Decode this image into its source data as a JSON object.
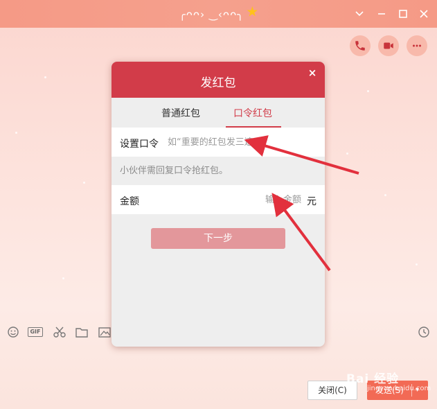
{
  "window": {
    "title": "╭ᴖᴖ› ‿‹ᴖᴖ╮",
    "badge_icon": "vip-star-icon",
    "controls": [
      "chevron-down-icon",
      "minimize-icon",
      "maximize-icon",
      "close-icon"
    ]
  },
  "call_buttons": [
    {
      "name": "voice-call",
      "icon": "phone-icon"
    },
    {
      "name": "video-call",
      "icon": "video-camera-icon"
    },
    {
      "name": "more",
      "icon": "more-dots-icon"
    }
  ],
  "dialog": {
    "title": "发红包",
    "close_label": "×",
    "tabs": [
      {
        "label": "普通红包",
        "active": false
      },
      {
        "label": "口令红包",
        "active": true
      }
    ],
    "password": {
      "label": "设置口令",
      "placeholder": "如“重要的红包发三遍”"
    },
    "hint": "小伙伴需回复口令抢红包。",
    "amount": {
      "label": "金额",
      "placeholder": "输入金额",
      "unit": "元"
    },
    "next_label": "下一步",
    "accent_color": "#d23c49"
  },
  "toolbar": {
    "gif_label": "GIF",
    "icons": [
      "emoji-icon",
      "gif-icon",
      "scissors-icon",
      "folder-icon",
      "image-icon",
      "history-clock-icon"
    ]
  },
  "footer": {
    "close_label": "关闭(C)",
    "send_label": "发送(S)",
    "send_color": "#f26a55"
  },
  "watermark": {
    "text": "Bai 经验",
    "sub": "jingyan.baidu.com"
  }
}
